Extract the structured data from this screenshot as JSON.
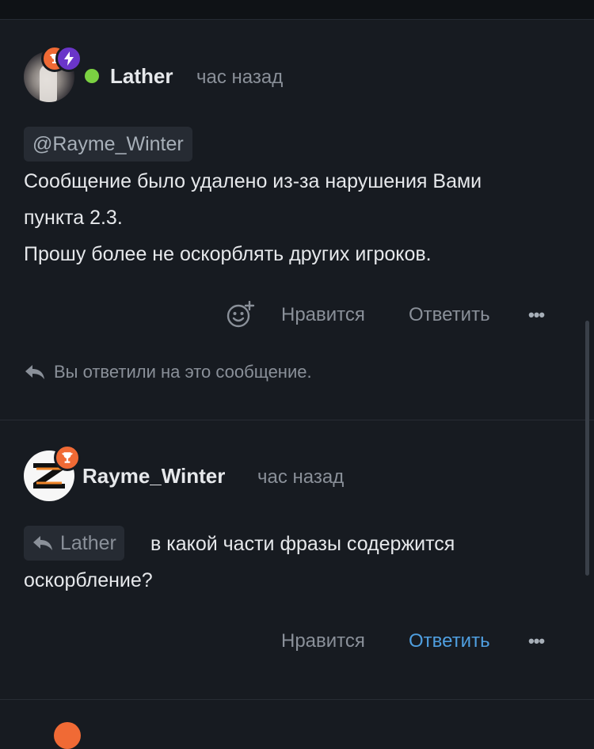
{
  "post1": {
    "username": "Lather",
    "time": "час назад",
    "mention": "@Rayme_Winter",
    "body_lines": [
      "Сообщение было удалено из-за нарушения Вами",
      "пункта 2.3.",
      "Прошу более не оскорблять других игроков."
    ],
    "actions": {
      "like": "Нравится",
      "reply": "Ответить",
      "more": "•••"
    },
    "replied_notice": "Вы ответили на это сообщение."
  },
  "post2": {
    "username": "Rayme_Winter",
    "time": "час назад",
    "quote_chip": "Lather",
    "body_first": "в какой части фразы содержится",
    "body_second": "оскорбление?",
    "actions": {
      "like": "Нравится",
      "reply": "Ответить",
      "more": "•••"
    }
  },
  "colors": {
    "background": "#171b21",
    "accent_blue": "#4f9fe0",
    "online_green": "#7bd142",
    "badge_orange": "#f06a35",
    "badge_purple": "#6a35c9"
  },
  "icons": [
    "reaction-add-icon",
    "reply-arrow-icon",
    "lightning-icon",
    "trophy-icon",
    "online-status-icon"
  ]
}
